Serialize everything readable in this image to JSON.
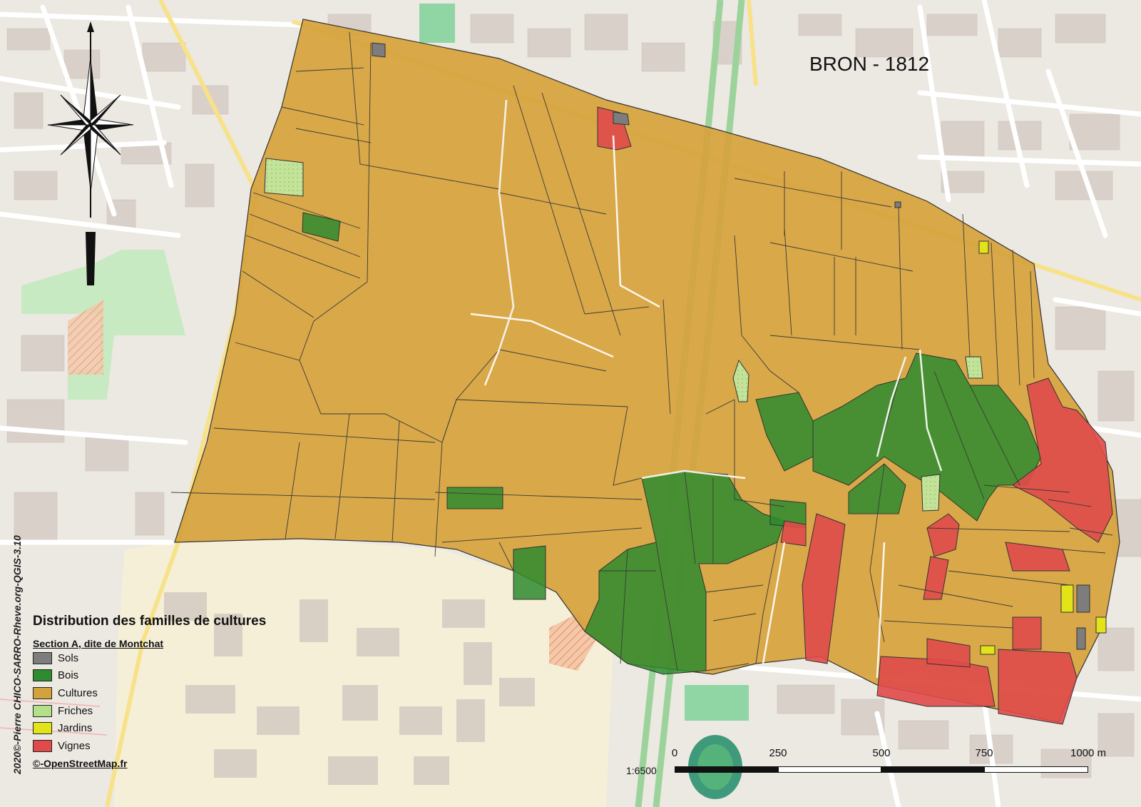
{
  "map": {
    "title": "BRON - 1812",
    "legend": {
      "title": "Distribution des familles de cultures",
      "section": "Section A, dite de Montchat",
      "items": [
        {
          "label": "Sols",
          "color": "#7d7d7d"
        },
        {
          "label": "Bois",
          "color": "#2e8b2e"
        },
        {
          "label": "Cultures",
          "color": "#d4a23c"
        },
        {
          "label": "Friches",
          "color": "#b5e08a"
        },
        {
          "label": "Jardins",
          "color": "#e3e31a"
        },
        {
          "label": "Vignes",
          "color": "#e04a4a"
        }
      ],
      "credit": "©-OpenStreetMap.fr"
    },
    "side_credit": "2020©-Pierre CHICO-SARRO-Rheve.org-QGIS-3.10",
    "scale": {
      "ratio": "1:6500",
      "ticks": [
        "0",
        "250",
        "500",
        "750",
        "1000 m"
      ]
    },
    "north_arrow": "compass-rose-icon"
  }
}
